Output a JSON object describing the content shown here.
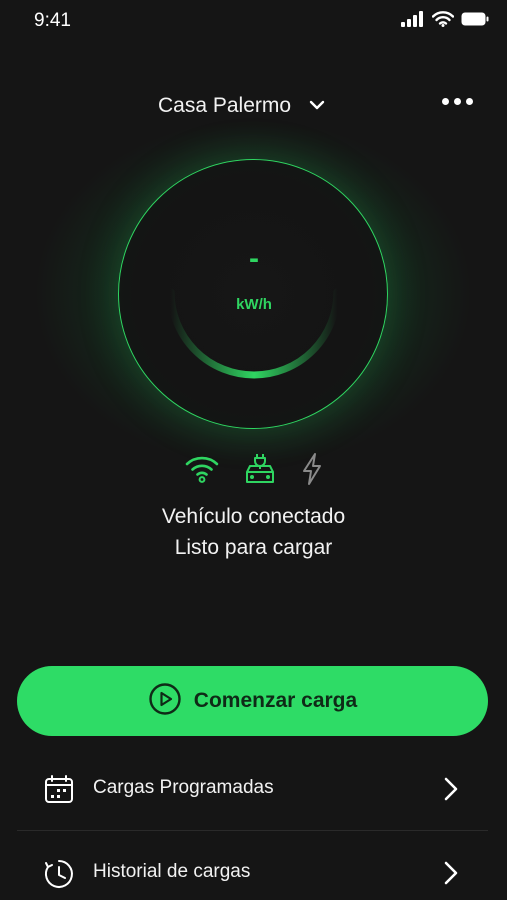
{
  "status_bar": {
    "time": "9:41"
  },
  "header": {
    "location": "Casa Palermo"
  },
  "gauge": {
    "value": "-",
    "unit": "kW/h"
  },
  "status": {
    "line1": "Vehículo conectado",
    "line2": "Listo para cargar"
  },
  "actions": {
    "start_label": "Comenzar carga"
  },
  "menu": {
    "items": [
      {
        "label": "Cargas Programadas",
        "icon": "calendar-icon"
      },
      {
        "label": "Historial de cargas",
        "icon": "history-clock-icon"
      }
    ]
  },
  "colors": {
    "accent": "#2edc66",
    "background": "#151515"
  }
}
